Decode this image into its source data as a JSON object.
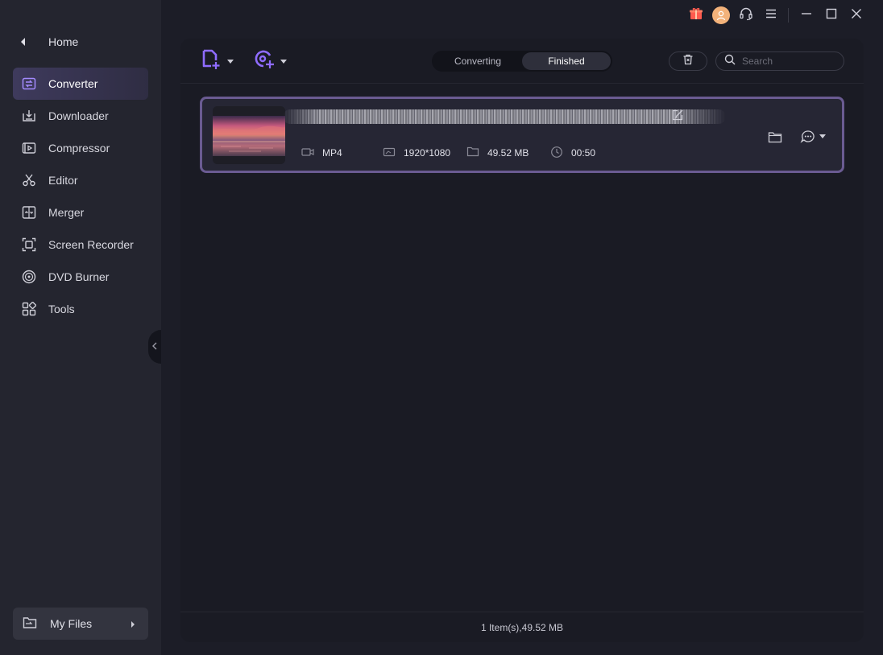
{
  "sidebar": {
    "home_label": "Home",
    "items": [
      {
        "label": "Converter",
        "icon": "converter-icon",
        "active": true
      },
      {
        "label": "Downloader",
        "icon": "downloader-icon",
        "active": false
      },
      {
        "label": "Compressor",
        "icon": "compressor-icon",
        "active": false
      },
      {
        "label": "Editor",
        "icon": "scissors-icon",
        "active": false
      },
      {
        "label": "Merger",
        "icon": "merger-icon",
        "active": false
      },
      {
        "label": "Screen Recorder",
        "icon": "screen-recorder-icon",
        "active": false
      },
      {
        "label": "DVD Burner",
        "icon": "disc-icon",
        "active": false
      },
      {
        "label": "Tools",
        "icon": "grid-icon",
        "active": false
      }
    ],
    "my_files_label": "My Files"
  },
  "tabs": [
    {
      "label": "Converting",
      "active": false
    },
    {
      "label": "Finished",
      "active": true
    }
  ],
  "search": {
    "placeholder": "Search",
    "value": ""
  },
  "file": {
    "format": "MP4",
    "resolution": "1920*1080",
    "size": "49.52 MB",
    "duration": "00:50"
  },
  "footer": {
    "summary": "1 Item(s),49.52 MB"
  },
  "colors": {
    "accent": "#7c5cf0",
    "sidebar_bg": "#24252f",
    "panel_bg": "#1a1b24",
    "item_border": "#6a5b92",
    "gift": "#ff5a4e",
    "avatar": "#f3b27a"
  }
}
